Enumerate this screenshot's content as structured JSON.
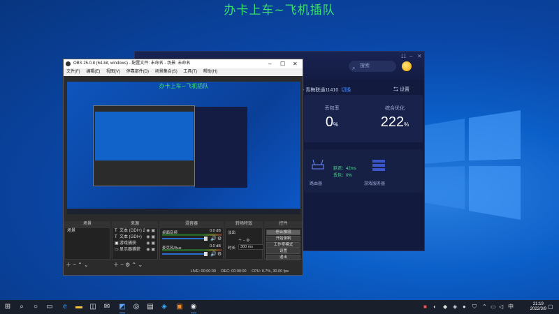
{
  "overlay": {
    "title": "办卡上车~飞机插队"
  },
  "accelerator": {
    "search_placeholder": "搜索",
    "window_controls": [
      "☷",
      "–",
      "✕"
    ],
    "server_label": "- 青梅联通11410",
    "switch_label": "切换",
    "settings_label": "设置",
    "stats": [
      {
        "label": "丢包率",
        "value": "0",
        "unit": "%"
      },
      {
        "label": "综合优化",
        "value": "222",
        "unit": "%"
      }
    ],
    "latency_label": "延迟：42ms",
    "loss_label": "丢包：0%",
    "router_label": "路由器",
    "server_node_label": "游戏服务器"
  },
  "obs": {
    "title": "OBS 25.0.8 (64-bit, windows) - 配置文件: 未命名 - 场景: 未命名",
    "window_controls": [
      "–",
      "☐",
      "✕"
    ],
    "menu": [
      "文件(F)",
      "编辑(E)",
      "视图(V)",
      "停靠部件(D)",
      "场景集合(S)",
      "工具(T)",
      "帮助(H)"
    ],
    "preview_title": "办卡上车~飞机插队",
    "panels": {
      "scenes": "场景",
      "sources": "来源",
      "mixer": "混音器",
      "transitions": "转场特效",
      "controls": "控件"
    },
    "scene_item": "场景",
    "sources": [
      {
        "icon": "T",
        "name": "文本 (GDI+) 2"
      },
      {
        "icon": "T",
        "name": "文本 (GDI+)"
      },
      {
        "icon": "▣",
        "name": "游戏捕获"
      },
      {
        "icon": "▭",
        "name": "显示器捕获"
      }
    ],
    "mixer": [
      {
        "name": "桌面音频",
        "db": "0.0 dB"
      },
      {
        "name": "麦克风/Aux",
        "db": "0.0 dB"
      }
    ],
    "transition": {
      "type": "淡出",
      "duration_label": "时长",
      "duration_value": "300 ms"
    },
    "controls": [
      "停止推流",
      "开始录制",
      "工作室模式",
      "设置",
      "退出"
    ],
    "status": {
      "live": "LIVE: 00:00:00",
      "rec": "REC: 00:00:00",
      "cpu": "CPU: 0.7%, 30.00 fps"
    }
  },
  "taskbar": {
    "time": "21:19",
    "date": "2022/3/9",
    "ime": "中"
  }
}
